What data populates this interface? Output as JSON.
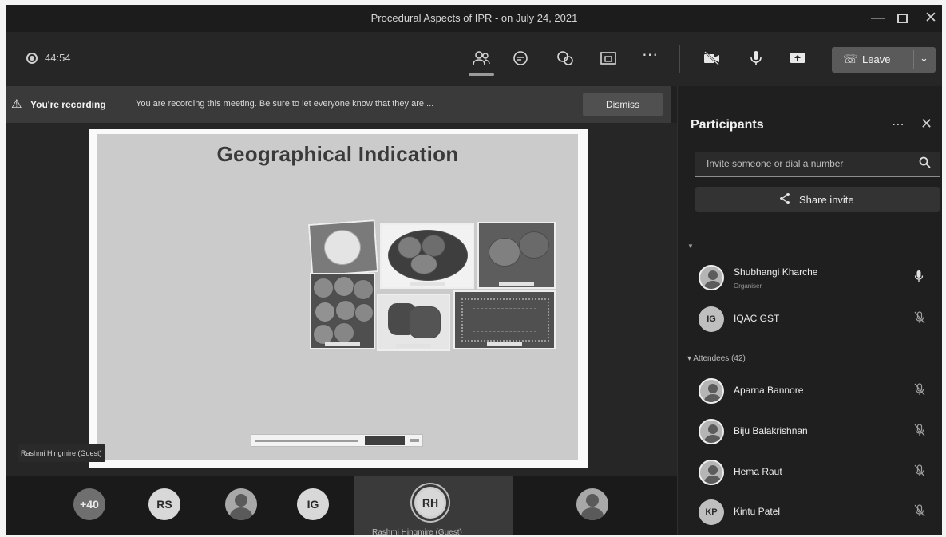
{
  "window": {
    "title": "Procedural Aspects of IPR - on July 24, 2021",
    "min_icon": "minimize-icon",
    "max_icon": "maximize-icon",
    "close_icon": "close-icon"
  },
  "toolbar": {
    "timer": "44:54",
    "icons": [
      "participants-icon",
      "chat-icon",
      "reactions-icon",
      "breakout-rooms-icon",
      "more-actions-icon",
      "camera-off-icon",
      "microphone-icon",
      "share-screen-icon"
    ],
    "leave_label": "Leave"
  },
  "recording_banner": {
    "bold": "You're recording",
    "message": "You are recording this meeting. Be sure to let everyone know that they are ...",
    "dismiss_label": "Dismiss"
  },
  "slide": {
    "title": "Geographical Indication",
    "presenter": "Rashmi Hingmire (Guest)"
  },
  "gallery": {
    "overflow_count": "+40",
    "avatars": [
      "RS",
      "IG",
      "RH"
    ],
    "active_name": "Rashmi Hingmire (Guest)"
  },
  "panel": {
    "title": "Participants",
    "invite_placeholder": "Invite someone or dial a number",
    "share_label": "Share invite",
    "attendees_header": "Attendees (42)",
    "presenters": [
      {
        "name": "Shubhangi Kharche",
        "role": "Organiser",
        "initials": ""
      },
      {
        "name": "IQAC GST",
        "role": "",
        "initials": "IG"
      }
    ],
    "attendees": [
      {
        "name": "Aparna Bannore",
        "initials": ""
      },
      {
        "name": "Biju Balakrishnan",
        "initials": ""
      },
      {
        "name": "Hema Raut",
        "initials": ""
      },
      {
        "name": "Kintu Patel",
        "initials": "KP"
      }
    ]
  }
}
